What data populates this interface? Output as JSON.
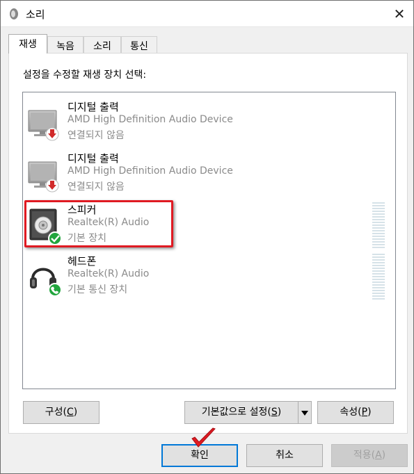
{
  "window": {
    "title": "소리",
    "close_glyph": "✕"
  },
  "tabs": [
    {
      "label": "재생"
    },
    {
      "label": "녹음"
    },
    {
      "label": "소리"
    },
    {
      "label": "통신"
    }
  ],
  "panel": {
    "prompt": "설정을 수정할 재생 장치 선택:"
  },
  "devices": [
    {
      "name": "디지털 출력",
      "driver": "AMD High Definition Audio Device",
      "status": "연결되지 않음",
      "icon": "monitor-disconnected-icon"
    },
    {
      "name": "디지털 출력",
      "driver": "AMD High Definition Audio Device",
      "status": "연결되지 않음",
      "icon": "monitor-disconnected-icon"
    },
    {
      "name": "스피커",
      "driver": "Realtek(R) Audio",
      "status": "기본 장치",
      "icon": "speaker-default-icon"
    },
    {
      "name": "헤드폰",
      "driver": "Realtek(R) Audio",
      "status": "기본 통신 장치",
      "icon": "headphones-communication-icon"
    }
  ],
  "buttons": {
    "configure": {
      "label": "구성(",
      "key": "C",
      "suffix": ")"
    },
    "set_default": {
      "label": "기본값으로 설정(",
      "key": "S",
      "suffix": ")"
    },
    "properties": {
      "label": "속성(",
      "key": "P",
      "suffix": ")"
    },
    "ok": "확인",
    "cancel": "취소",
    "apply": {
      "label": "적용(",
      "key": "A",
      "suffix": ")"
    }
  },
  "colors": {
    "highlight_border": "#e01a22",
    "focus_border": "#0078d7",
    "check_green": "#21a53d",
    "disconnect_red": "#d12a2a"
  }
}
